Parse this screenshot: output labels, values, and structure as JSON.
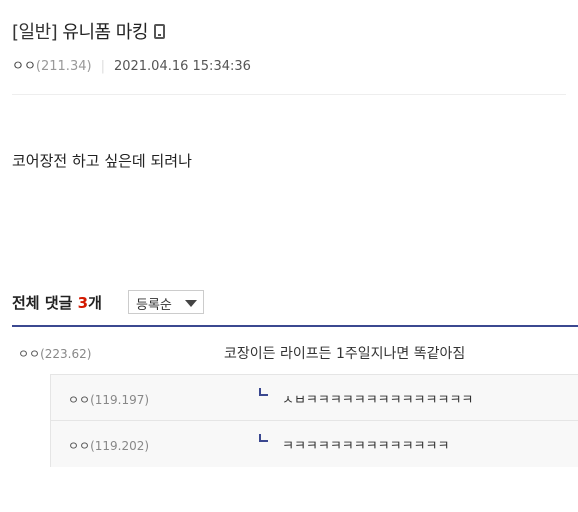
{
  "post": {
    "category": "[일반]",
    "title": "유니폼 마킹",
    "author": "ㅇㅇ",
    "author_ip": "(211.34)",
    "datetime": "2021.04.16 15:34:36",
    "body": "코어장전 하고 싶은데 되려나"
  },
  "comments_header": {
    "label": "전체 댓글",
    "count": "3",
    "unit": "개",
    "sort_selected": "등록순"
  },
  "comments": [
    {
      "nick": "ㅇㅇ",
      "ip": "(223.62)",
      "text": "코장이든 라이프든 1주일지나면 똑같아짐"
    }
  ],
  "replies": [
    {
      "nick": "ㅇㅇ",
      "ip": "(119.197)",
      "text": "ㅅㅂㅋㅋㅋㅋㅋㅋㅋㅋㅋㅋㅋㅋㅋㅋ"
    },
    {
      "nick": "ㅇㅇ",
      "ip": "(119.202)",
      "text": "ㅋㅋㅋㅋㅋㅋㅋㅋㅋㅋㅋㅋㅋㅋ"
    }
  ]
}
